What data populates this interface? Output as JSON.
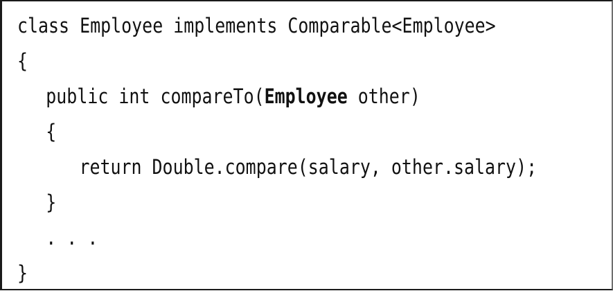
{
  "code": {
    "line1": "class Employee implements Comparable<Employee>",
    "line2": "{",
    "line3_prefix": "public int compareTo(",
    "line3_bold": "Employee",
    "line3_suffix": " other)",
    "line4": "{",
    "line5": "return Double.compare(salary, other.salary);",
    "line6": "}",
    "line7": ". . .",
    "line8": "}"
  }
}
